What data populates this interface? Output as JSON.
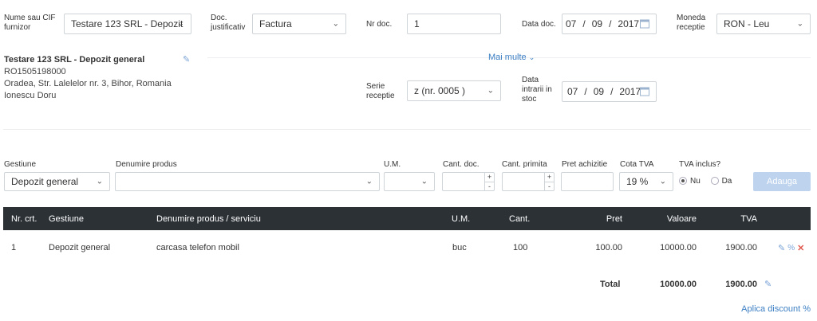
{
  "header": {
    "supplier_label": "Nume sau CIF furnizor",
    "supplier_value": "Testare 123 SRL - Depozit",
    "doc_label": "Doc. justificativ",
    "doc_value": "Factura",
    "nrdoc_label": "Nr doc.",
    "nrdoc_value": "1",
    "datadoc_label": "Data doc.",
    "datadoc": {
      "day": "07",
      "month": "09",
      "year": "2017",
      "sep": "/"
    },
    "currency_label": "Moneda receptie",
    "currency_value": "RON - Leu"
  },
  "supplier": {
    "name": "Testare 123 SRL - Depozit general",
    "cif": "RO1505198000",
    "address": "Oradea, Str. Lalelelor nr. 3, Bihor, Romania",
    "person": "Ionescu Doru"
  },
  "more_label": "Mai multe",
  "receipt": {
    "serie_label": "Serie receptie",
    "serie_value": "z (nr. 0005 )",
    "stock_date_label": "Data intrarii in stoc",
    "stock_date": {
      "day": "07",
      "month": "09",
      "year": "2017",
      "sep": "/"
    }
  },
  "form": {
    "gestiune_label": "Gestiune",
    "gestiune_value": "Depozit general",
    "produs_label": "Denumire produs",
    "um_label": "U.M.",
    "cantdoc_label": "Cant. doc.",
    "cantprim_label": "Cant. primita",
    "pret_label": "Pret achizitie",
    "cota_label": "Cota TVA",
    "cota_value": "19 %",
    "tvainc_label": "TVA inclus?",
    "nu_label": "Nu",
    "da_label": "Da",
    "add_label": "Adauga",
    "plus": "+",
    "minus": "-"
  },
  "table": {
    "headers": [
      "Nr. crt.",
      "Gestiune",
      "Denumire produs / serviciu",
      "U.M.",
      "Cant.",
      "Pret",
      "Valoare",
      "TVA"
    ],
    "rows": [
      [
        "1",
        "Depozit general",
        "carcasa telefon mobil",
        "buc",
        "100",
        "100.00",
        "10000.00",
        "1900.00"
      ]
    ],
    "row_percent": "%",
    "total_label": "Total",
    "total_value": "10000.00",
    "total_tva": "1900.00",
    "discount_label": "Aplica discount %"
  }
}
